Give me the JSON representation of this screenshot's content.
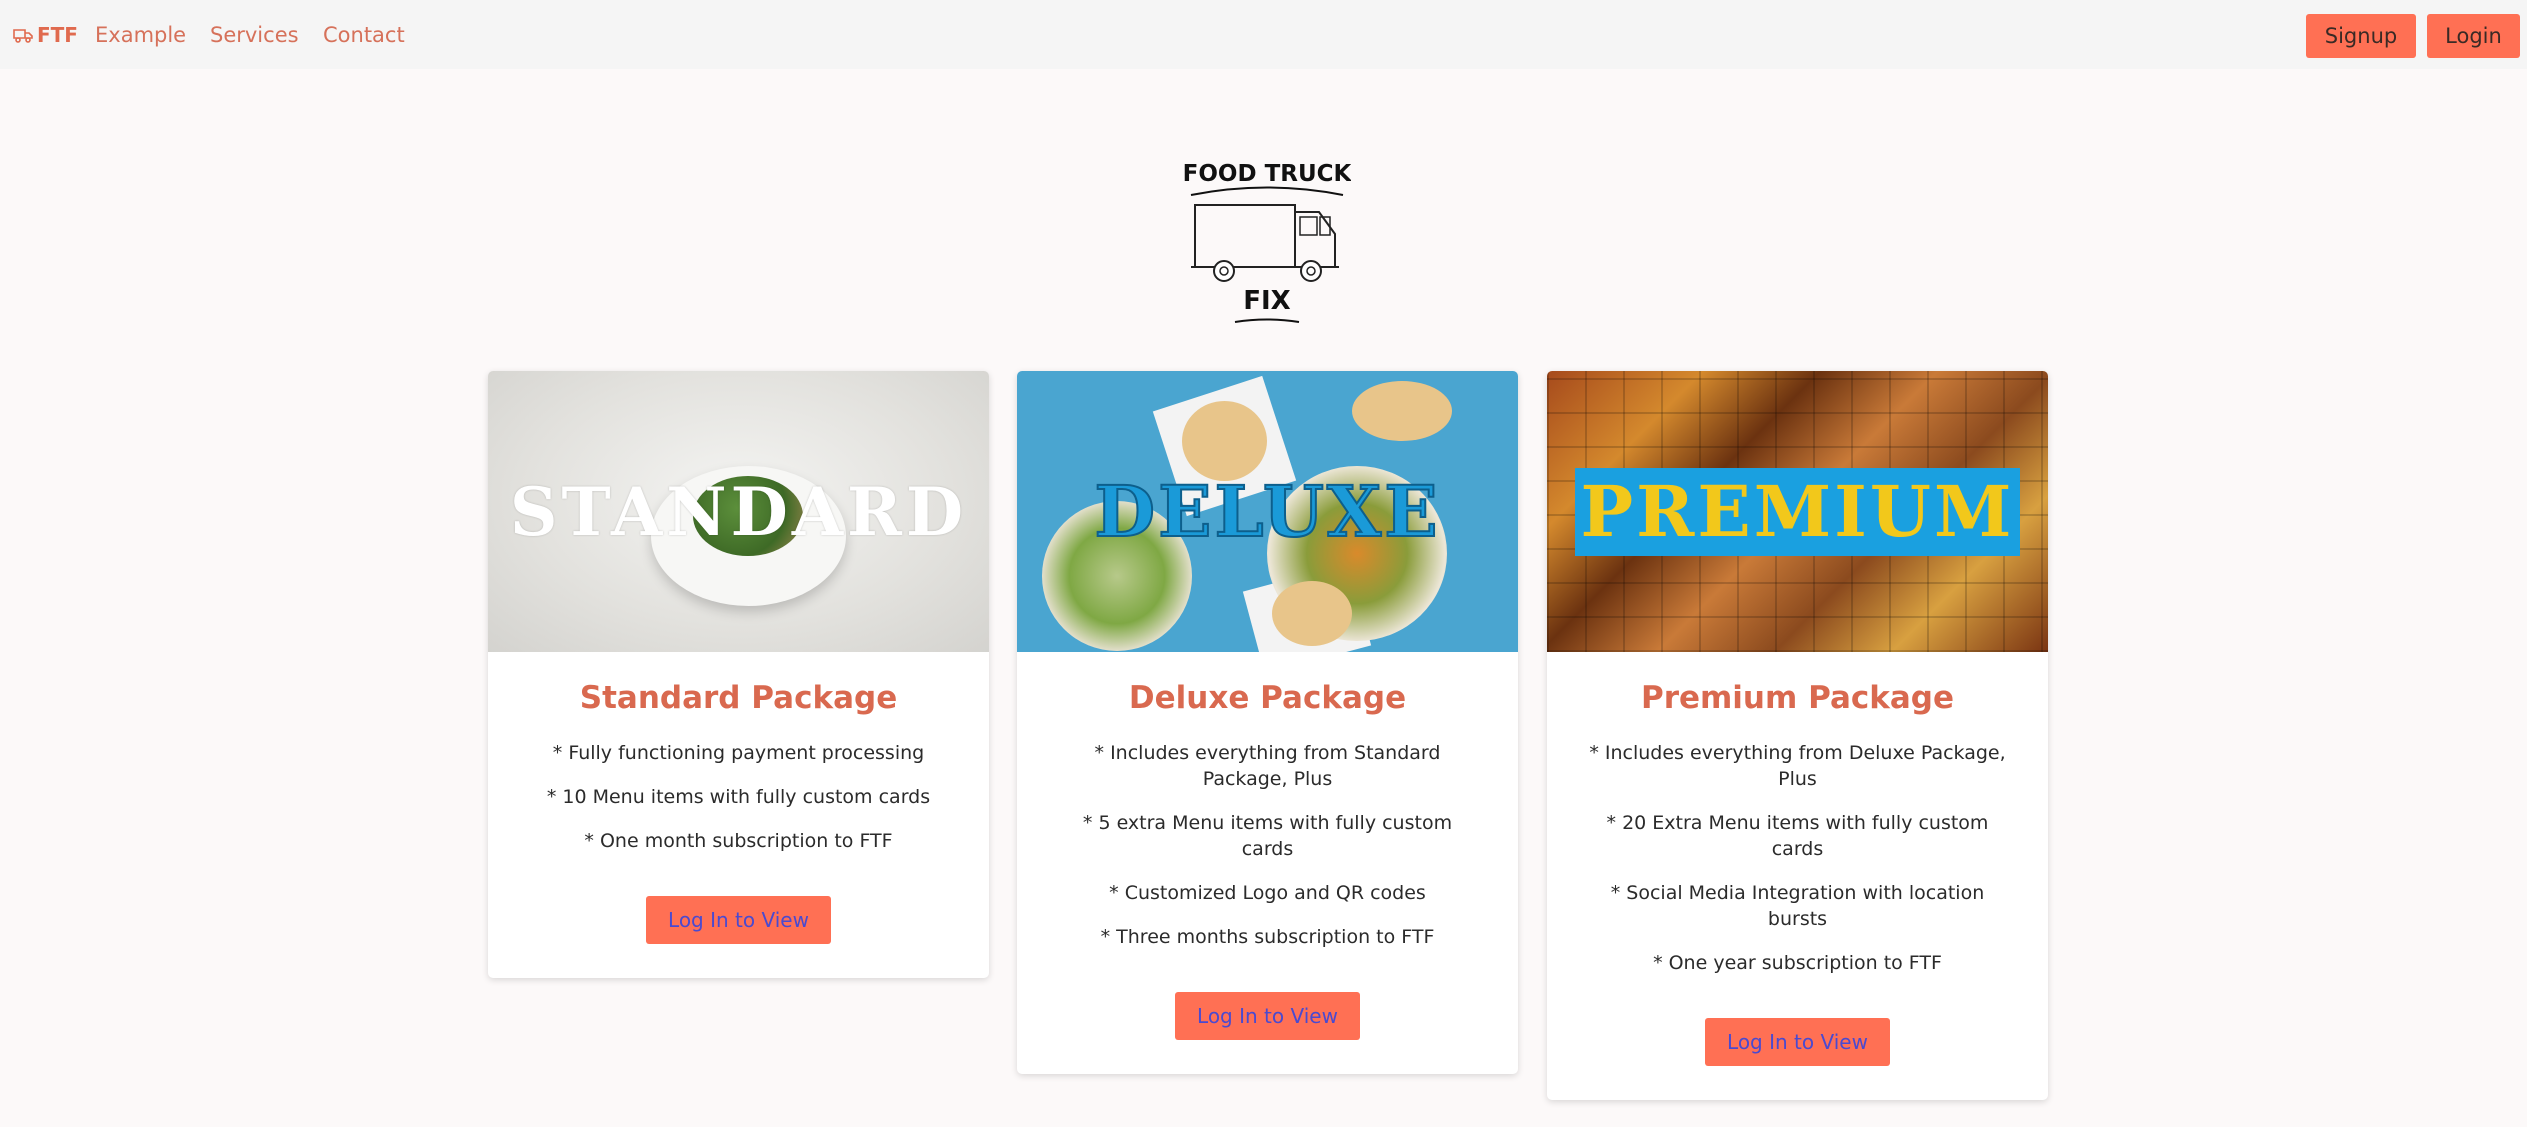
{
  "nav": {
    "brand": "FTF",
    "links": [
      "Example",
      "Services",
      "Contact"
    ],
    "signup": "Signup",
    "login": "Login"
  },
  "logo": {
    "line1": "FOOD TRUCK",
    "line2": "FIX"
  },
  "cards": [
    {
      "banner": "STANDARD",
      "title": "Standard Package",
      "features": [
        "* Fully functioning payment processing",
        "* 10 Menu items with fully custom cards",
        "* One month subscription to FTF"
      ],
      "button": "Log In to View"
    },
    {
      "banner": "DELUXE",
      "title": "Deluxe Package",
      "features": [
        "* Includes everything from Standard Package, Plus",
        "* 5 extra Menu items with fully custom cards",
        "* Customized Logo and QR codes",
        "* Three months subscription to FTF"
      ],
      "button": "Log In to View"
    },
    {
      "banner": "PREMIUM",
      "title": "Premium Package",
      "features": [
        "* Includes everything from Deluxe Package, Plus",
        "* 20 Extra Menu items with fully custom cards",
        "* Social Media Integration with location bursts",
        "* One year subscription to FTF"
      ],
      "button": "Log In to View"
    }
  ],
  "colors": {
    "accent": "#ff7054",
    "title": "#d9694f",
    "nav_bg": "#f5f5f5",
    "page_bg": "#fcf9f9",
    "button_text": "#4a4ad0"
  },
  "icons": {
    "brand": "food-truck-icon"
  }
}
